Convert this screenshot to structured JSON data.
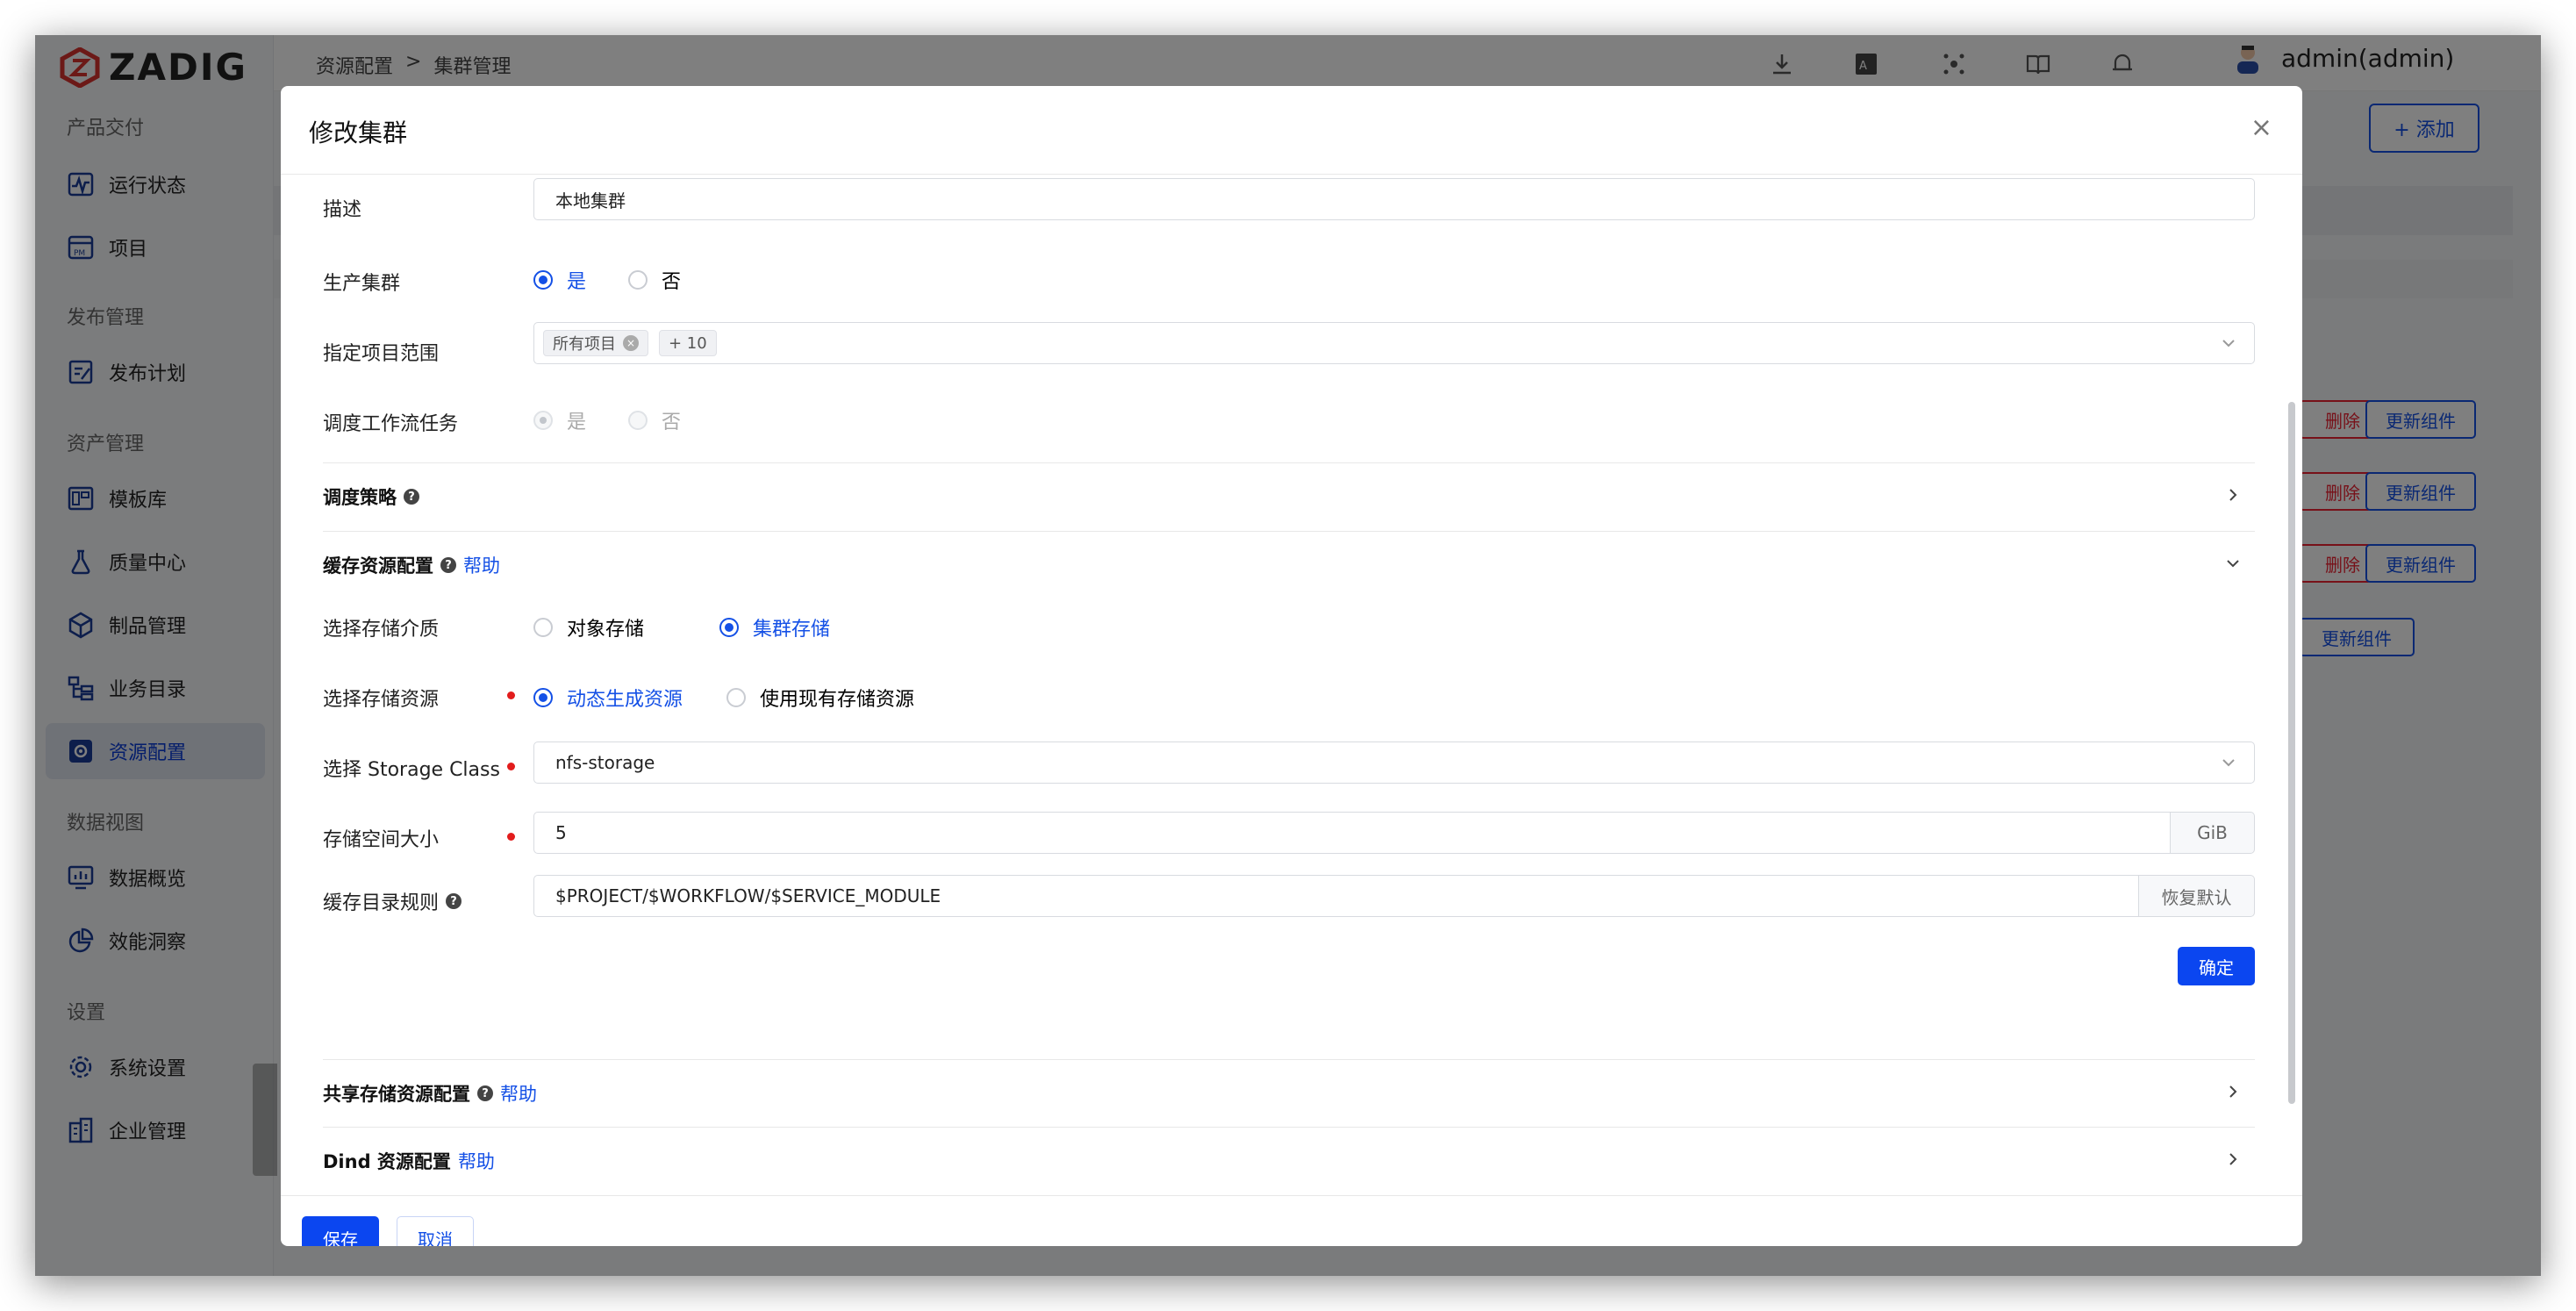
{
  "app": {
    "logo": "ZADIG"
  },
  "sidebar": {
    "sections": [
      {
        "title": "产品交付",
        "items": [
          {
            "label": "运行状态",
            "icon": "activity-icon"
          },
          {
            "label": "项目",
            "icon": "project-icon"
          }
        ]
      },
      {
        "title": "发布管理",
        "items": [
          {
            "label": "发布计划",
            "icon": "release-plan-icon"
          }
        ]
      },
      {
        "title": "资产管理",
        "items": [
          {
            "label": "模板库",
            "icon": "template-icon"
          },
          {
            "label": "质量中心",
            "icon": "flask-icon"
          },
          {
            "label": "制品管理",
            "icon": "artifact-icon"
          },
          {
            "label": "业务目录",
            "icon": "catalog-icon"
          },
          {
            "label": "资源配置",
            "icon": "resource-gear-icon",
            "active": true
          }
        ]
      },
      {
        "title": "数据视图",
        "items": [
          {
            "label": "数据概览",
            "icon": "monitor-icon"
          },
          {
            "label": "效能洞察",
            "icon": "pie-chart-icon"
          }
        ]
      },
      {
        "title": "设置",
        "items": [
          {
            "label": "系统设置",
            "icon": "gear-icon"
          },
          {
            "label": "企业管理",
            "icon": "building-icon"
          }
        ]
      }
    ]
  },
  "header": {
    "breadcrumb": [
      "资源配置",
      ">",
      "集群管理"
    ],
    "user": "admin(admin)"
  },
  "background": {
    "add_button": "+ 添加",
    "delete_label": "删除",
    "update_label": "更新组件"
  },
  "modal": {
    "title": "修改集群",
    "close": "×",
    "desc_label": "描述",
    "desc_value": "本地集群",
    "prod_label": "生产集群",
    "yes": "是",
    "no": "否",
    "scope_label": "指定项目范围",
    "scope_tag": "所有项目",
    "scope_more": "+ 10",
    "schedule_label": "调度工作流任务",
    "strategy_title": "调度策略",
    "cache_title": "缓存资源配置",
    "help": "帮助",
    "medium_label": "选择存储介质",
    "medium_object": "对象存储",
    "medium_cluster": "集群存储",
    "resource_label": "选择存储资源",
    "resource_dynamic": "动态生成资源",
    "resource_existing": "使用现有存储资源",
    "storage_class_label": "选择 Storage Class",
    "storage_class_value": "nfs-storage",
    "size_label": "存储空间大小",
    "size_value": "5",
    "size_unit": "GiB",
    "cache_dir_label": "缓存目录规则",
    "cache_dir_value": "$PROJECT/$WORKFLOW/$SERVICE_MODULE",
    "restore_default": "恢复默认",
    "confirm": "确定",
    "shared_title": "共享存储资源配置",
    "dind_title": "Dind 资源配置",
    "save": "保存",
    "cancel": "取消"
  }
}
